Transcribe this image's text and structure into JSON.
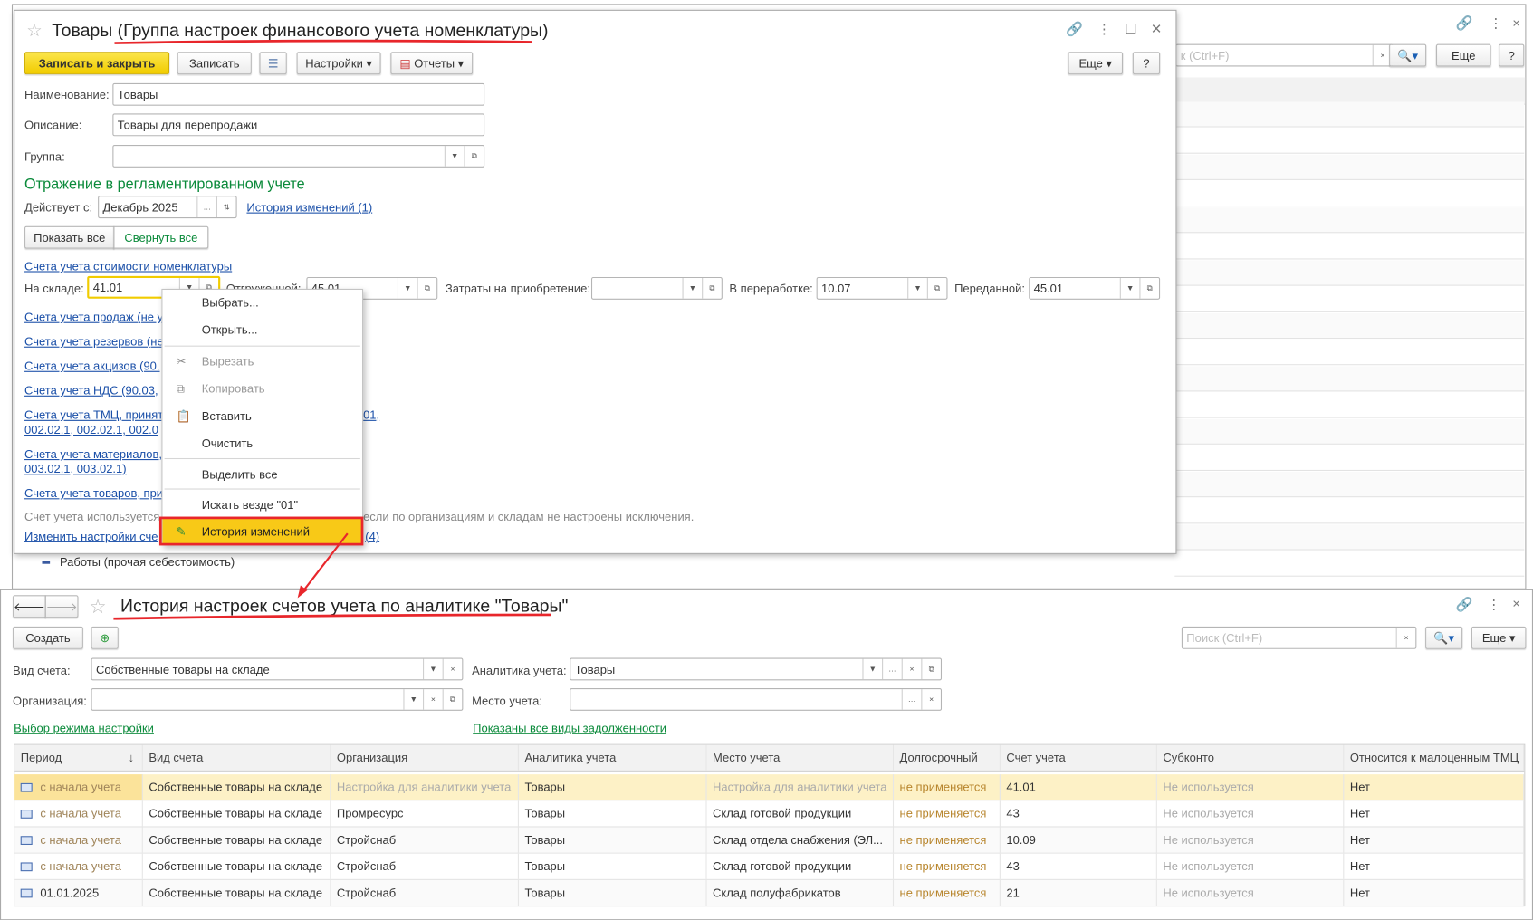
{
  "background_window": {
    "search_placeholder": "к (Ctrl+F)",
    "more": "Еще",
    "help": "?",
    "tree_items": [
      "Работы (прочая себестоимость)"
    ]
  },
  "dialog": {
    "title": "Товары (Группа настроек финансового учета номенклатуры)",
    "toolbar": {
      "save_close": "Записать и закрыть",
      "save": "Записать",
      "settings": "Настройки",
      "reports": "Отчеты",
      "more": "Еще",
      "help": "?"
    },
    "fields": {
      "name_label": "Наименование:",
      "name_value": "Товары",
      "desc_label": "Описание:",
      "desc_value": "Товары для перепродажи",
      "group_label": "Группа:",
      "group_value": ""
    },
    "section_title": "Отражение в регламентированном учете",
    "effective_label": "Действует с:",
    "effective_value": "Декабрь 2025",
    "history_link": "История изменений (1)",
    "show_all": "Показать все",
    "collapse_all": "Свернуть все",
    "cost_accounts_link": "Счета учета стоимости номенклатуры",
    "warehouse_label": "На складе:",
    "warehouse_value": "41.01",
    "shipped_label": "Отгруженной:",
    "shipped_value": "45.01",
    "acq_label": "Затраты на приобретение:",
    "acq_value": "",
    "processing_label": "В переработке:",
    "processing_value": "10.07",
    "transferred_label": "Переданной:",
    "transferred_value": "45.01",
    "links": [
      "Счета учета продаж (не у",
      "Счета учета резервов (не",
      "Счета учета акцизов (90.",
      "Счета учета НДС (90.03,",
      "Счета учета ТМЦ, принят",
      "002.02.1, 002.02.1, 002.0",
      "Счета учета материалов,",
      "003.02.1, 003.02.1)",
      "Счета учета товаров, при"
    ],
    "links_right": [
      "01,"
    ],
    "note_left": "Счет учета используется",
    "note_right": "если  по организациям и складам не настроены исключения.",
    "change_link_left": "Изменить настройки сче",
    "change_link_right": "(4)"
  },
  "context_menu": [
    {
      "label": "Выбрать...",
      "disabled": false,
      "icon": ""
    },
    {
      "label": "Открыть...",
      "disabled": false,
      "icon": ""
    },
    {
      "label": "Вырезать",
      "disabled": true,
      "icon": "scissors-icon"
    },
    {
      "label": "Копировать",
      "disabled": true,
      "icon": "copy-icon"
    },
    {
      "label": "Вставить",
      "disabled": false,
      "icon": "paste-icon"
    },
    {
      "label": "Очистить",
      "disabled": false,
      "icon": ""
    },
    {
      "label": "Выделить все",
      "disabled": false,
      "icon": ""
    },
    {
      "label": "Искать везде \"01\"",
      "disabled": false,
      "icon": ""
    },
    {
      "label": "История изменений",
      "disabled": false,
      "icon": "history-icon",
      "highlighted": true
    }
  ],
  "history_window": {
    "title": "История настроек счетов учета по аналитике \"Товары\"",
    "create": "Создать",
    "search_placeholder": "Поиск (Ctrl+F)",
    "more": "Еще",
    "filters": {
      "account_type_label": "Вид счета:",
      "account_type_value": "Собственные товары на складе",
      "analytics_label": "Аналитика учета:",
      "analytics_value": "Товары",
      "org_label": "Организация:",
      "org_value": "",
      "place_label": "Место учета:",
      "place_value": ""
    },
    "mode_link": "Выбор режима настройки",
    "debt_link": "Показаны все виды задолженности",
    "columns": [
      "Период",
      "Вид счета",
      "Организация",
      "Аналитика учета",
      "Место учета",
      "Долгосрочный",
      "Счет учета",
      "Субконто",
      "Относится к малоценным ТМЦ"
    ],
    "rows": [
      [
        "с начала учета",
        "Собственные товары на складе",
        "Настройка для аналитики учета",
        "Товары",
        "Настройка для аналитики учета",
        "не применяется",
        "41.01",
        "Не используется",
        "Нет"
      ],
      [
        "с начала учета",
        "Собственные товары на складе",
        "Промресурс",
        "Товары",
        "Склад готовой продукции",
        "не применяется",
        "43",
        "Не используется",
        "Нет"
      ],
      [
        "с начала учета",
        "Собственные товары на складе",
        "Стройснаб",
        "Товары",
        "Склад отдела снабжения (ЭЛ...",
        "не применяется",
        "10.09",
        "Не используется",
        "Нет"
      ],
      [
        "с начала учета",
        "Собственные товары на складе",
        "Стройснаб",
        "Товары",
        "Склад готовой продукции",
        "не применяется",
        "43",
        "Не используется",
        "Нет"
      ],
      [
        "01.01.2025",
        "Собственные товары на складе",
        "Стройснаб",
        "Товары",
        "Склад полуфабрикатов",
        "не применяется",
        "21",
        "Не используется",
        "Нет"
      ]
    ]
  },
  "colors": {
    "accent_yellow": "#f1cc00",
    "link_blue": "#1a4fa8",
    "section_green": "#0a8a3a",
    "annotation_red": "#e8262b",
    "selected_row": "#fdf1c6"
  }
}
